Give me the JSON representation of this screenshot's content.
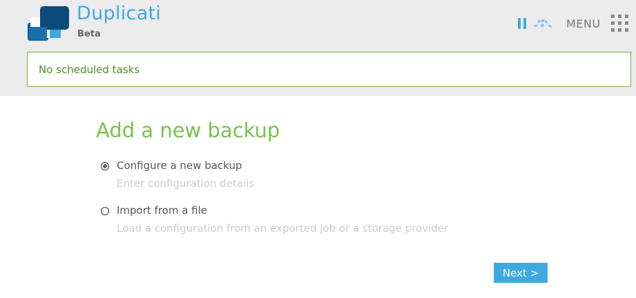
{
  "header": {
    "app_name": "Duplicati",
    "app_subtitle": "Beta",
    "menu_label": "MENU",
    "icons": [
      "duplicati-logo",
      "pause-icon",
      "throttle-icon",
      "menu-grid-icon"
    ]
  },
  "status": {
    "text": "No scheduled tasks"
  },
  "main": {
    "title": "Add a new backup",
    "options": [
      {
        "label": "Configure a new backup",
        "description": "Enter configuration details",
        "selected": true
      },
      {
        "label": "Import from a file",
        "description": "Load a configuration from an exported job or a storage provider",
        "selected": false
      }
    ],
    "next_label": "Next >"
  },
  "colors": {
    "brand_blue": "#3ea9e0",
    "title_green": "#78c24c",
    "status_border": "#76b043",
    "header_bg": "#ececec"
  }
}
